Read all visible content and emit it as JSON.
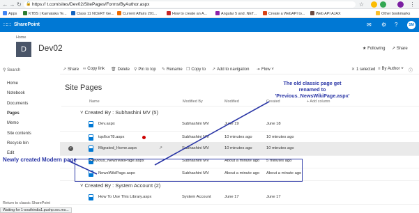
{
  "browser": {
    "url": "https://                t.com/sites/Dev02/SitePages/Forms/ByAuthor.aspx",
    "bookmarks": [
      {
        "label": "Apps",
        "color": "#4285f4"
      },
      {
        "label": "KTBS | Karnataka Te...",
        "color": "#2e7d32"
      },
      {
        "label": "Class 11 NCERT Ge...",
        "color": "#1565c0"
      },
      {
        "label": "Current Affairs 201...",
        "color": "#ef6c00"
      },
      {
        "label": "How to create an A...",
        "color": "#c62828"
      },
      {
        "label": "Angular 5 and .NET...",
        "color": "#8e24aa"
      },
      {
        "label": "Create a WebAPI to...",
        "color": "#d84315"
      },
      {
        "label": "Web API AJAX",
        "color": "#6d4c41"
      },
      {
        "label": "Other bookmarks",
        "color": "#fbc02d"
      }
    ],
    "status": "Waiting for 1-southindia1.pushp.svc.ms..."
  },
  "suite": {
    "app_name": "SharePoint",
    "user_initials": "SM"
  },
  "site": {
    "home_label": "Home",
    "logo_letter": "D",
    "title": "Dev02",
    "following": "Following",
    "share": "Share"
  },
  "left_nav": {
    "search_label": "Search",
    "items": [
      "Home",
      "Notebook",
      "Documents",
      "Pages",
      "Memo",
      "Site contents",
      "Recycle bin",
      "Edit"
    ],
    "return_link": "Return to classic SharePoint"
  },
  "command_bar": {
    "share": "Share",
    "copy_link": "Copy link",
    "delete": "Delete",
    "pin_to_top": "Pin to top",
    "rename": "Rename",
    "copy_to": "Copy to",
    "add_to_navigation": "Add to navigation",
    "flow": "Flow",
    "selected": "1 selected",
    "view": "By Author"
  },
  "library": {
    "title": "Site Pages",
    "columns": {
      "name": "Name",
      "modified_by": "Modified By",
      "modified": "Modified",
      "created": "Created",
      "add_column": "+ Add column"
    },
    "groups": [
      {
        "label": "Created By : Subhashini MV (5)",
        "rows": [
          {
            "name": "Dev.aspx",
            "modified_by": "Subhashini MV",
            "modified": "June 19",
            "created": "June 18"
          },
          {
            "name": "tqs6co78.aspx",
            "modified_by": "Subhashini MV",
            "modified": "10 minutes ago",
            "created": "10 minutes ago"
          },
          {
            "name": "Migrated_Home.aspx",
            "modified_by": "Subhashini MV",
            "modified": "10 minutes ago",
            "created": "10 minutes ago"
          },
          {
            "name": "Previous_NewsWikiPage.aspx",
            "modified_by": "Subhashini MV",
            "modified": "About a minute ago",
            "created": "5 minutes ago"
          },
          {
            "name": "NewsWikiPage.aspx",
            "modified_by": "Subhashini MV",
            "modified": "About a minute ago",
            "created": "About a minute ago"
          }
        ]
      },
      {
        "label": "Created By : System Account (2)",
        "rows": [
          {
            "name": "How To Use This Library.aspx",
            "modified_by": "System Account",
            "modified": "June 17",
            "created": "June 17"
          }
        ]
      }
    ]
  },
  "annotations": {
    "classic_renamed": [
      "The old classic page get",
      "renamed to",
      "'Previous_NewsWikiPage.aspx'"
    ],
    "modern_created": "Newly created Modern page",
    "color": "#2a36a6"
  }
}
